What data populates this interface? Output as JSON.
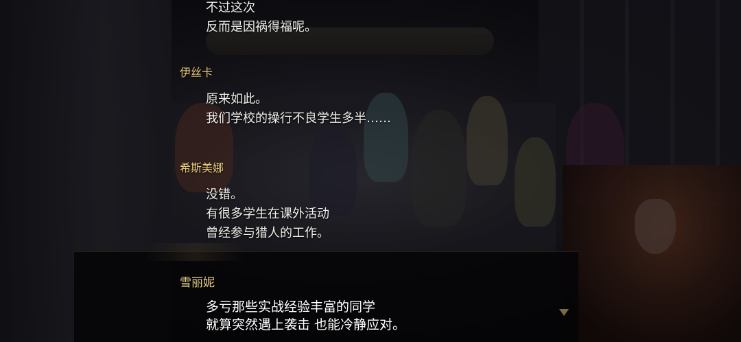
{
  "backlog": [
    {
      "speaker": "",
      "lines": [
        "不过这次",
        "反而是因祸得福呢。"
      ]
    },
    {
      "speaker": "伊丝卡",
      "lines": [
        "原来如此。",
        "我们学校的操行不良学生多半……"
      ]
    },
    {
      "speaker": "希斯美娜",
      "lines": [
        "没错。",
        "有很多学生在课外活动",
        "曾经参与猎人的工作。"
      ]
    }
  ],
  "current": {
    "speaker": "雪丽妮",
    "lines": [
      "多亏那些实战经验丰富的同学",
      "就算突然遇上袭击 也能冷静应对。"
    ]
  },
  "colors": {
    "speaker": "#e6cc7a",
    "text": "#f2f0ec"
  }
}
